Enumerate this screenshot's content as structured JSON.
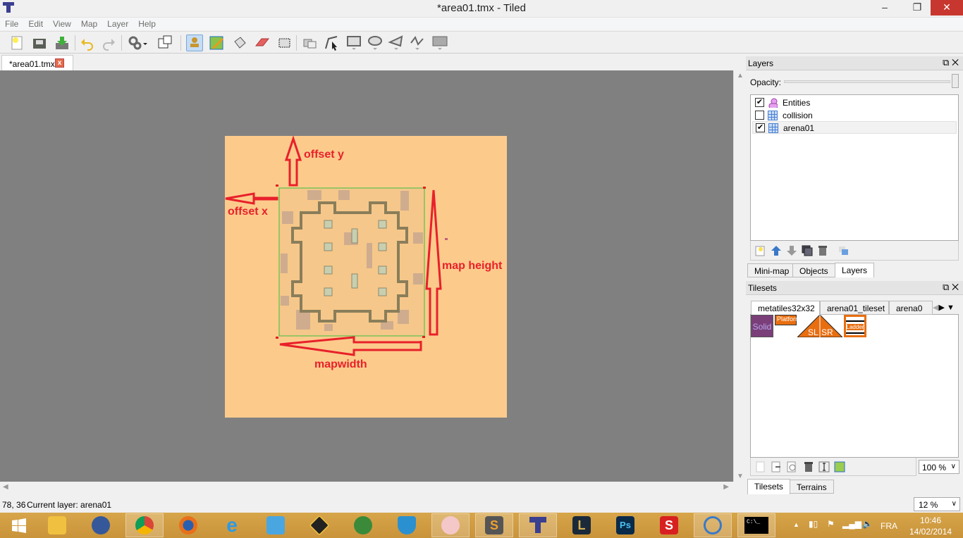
{
  "window": {
    "title": "*area01.tmx - Tiled",
    "minimize": "–",
    "maximize": "❐",
    "close": "✕"
  },
  "menu": [
    "File",
    "Edit",
    "View",
    "Map",
    "Layer",
    "Help"
  ],
  "toolbar": [
    "new-icon",
    "open-icon",
    "save-icon",
    "undo-icon",
    "redo-icon",
    "command-icon",
    "random-dice-icon",
    "stamp-brush-icon",
    "terrain-brush-icon",
    "bucket-fill-icon",
    "eraser-icon",
    "rect-select-icon",
    "select-objects-icon",
    "edit-polygons-icon",
    "insert-rectangle-icon",
    "insert-ellipse-icon",
    "insert-polygon-icon",
    "insert-polyline-icon",
    "insert-tile-icon"
  ],
  "doc_tab": {
    "label": "*area01.tmx",
    "close": "x"
  },
  "annotations": {
    "offset_y": "offset y",
    "offset_x": "offset x",
    "map_height": "map height",
    "map_width": "mapwidth",
    "color": "#e8202a"
  },
  "layers_panel": {
    "title": "Layers",
    "opacity_label": "Opacity:",
    "opacity": 1.0,
    "layers": [
      {
        "name": "Entities",
        "visible": true,
        "type": "object"
      },
      {
        "name": "collision",
        "visible": false,
        "type": "tile"
      },
      {
        "name": "arena01",
        "visible": true,
        "type": "tile",
        "selected": true
      }
    ],
    "tabs": [
      "Mini-map",
      "Objects",
      "Layers"
    ],
    "active_tab": "Layers"
  },
  "tilesets_panel": {
    "title": "Tilesets",
    "tabs": [
      "metatiles32x32",
      "arena01_tileset",
      "arena0"
    ],
    "tiles": [
      "Solid",
      "Platform",
      "SL",
      "SR",
      "Ladder"
    ],
    "zoom": "100 %",
    "bottom_tabs": [
      "Tilesets",
      "Terrains"
    ]
  },
  "status": {
    "coords": "78, 36",
    "current_layer": "Current layer: arena01",
    "zoom": "12 %"
  },
  "tray": {
    "lang": "FRA",
    "time": "10:46",
    "date": "14/02/2014",
    "cmd": "C:\\_"
  },
  "taskbar": [
    "start",
    "file-explorer",
    "globe",
    "chrome",
    "firefox",
    "internet-explorer",
    "app-bird",
    "app-arrows",
    "network-globe",
    "shield",
    "scissors",
    "sublime-text",
    "tiled",
    "league-of-legends",
    "photoshop",
    "app-s",
    "app-sync",
    "command-prompt"
  ]
}
